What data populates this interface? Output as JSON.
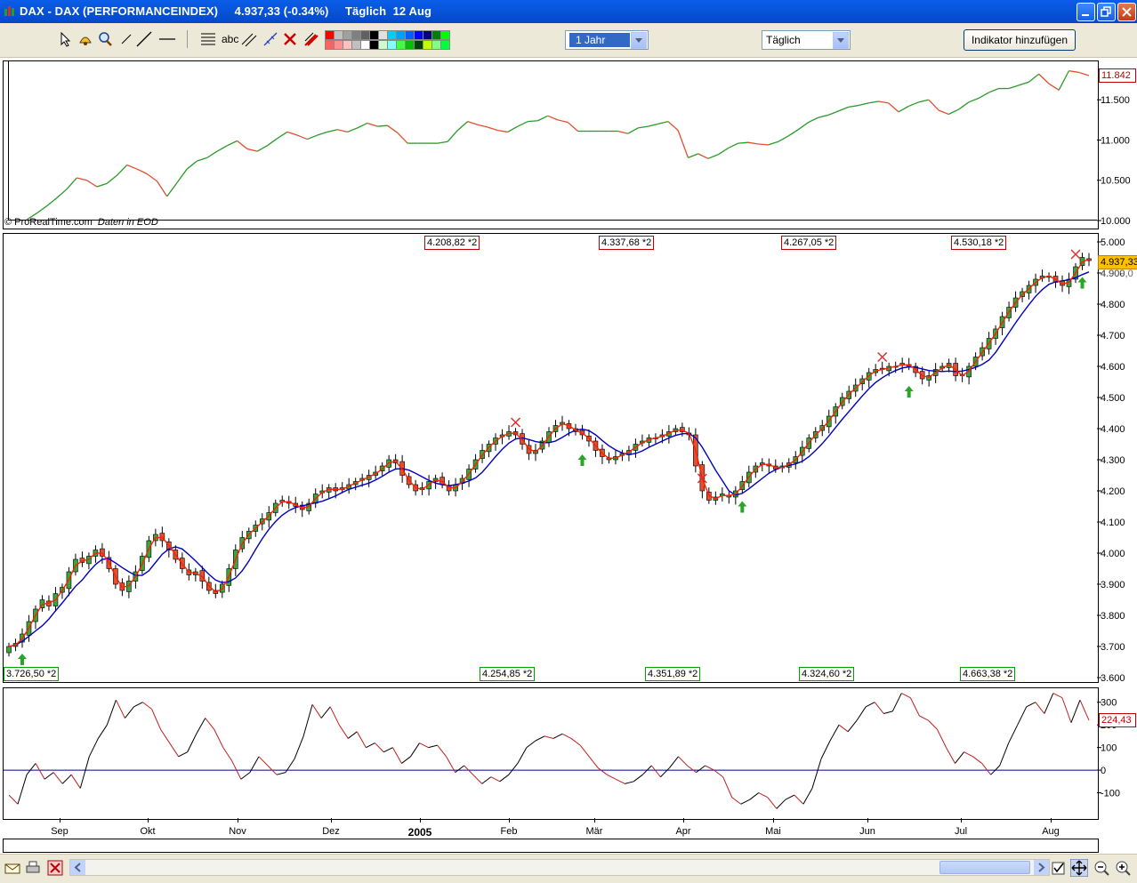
{
  "window": {
    "title": "DAX - DAX (PERFORMANCEINDEX)     4.937,33 (-0.34%)     Täglich  12 Aug"
  },
  "toolbar": {
    "period_select": "1 Jahr",
    "interval_select": "Täglich",
    "add_indicator_label": "Indikator hinzufügen",
    "text_tool_label": "abc",
    "palette": [
      "#ff0000",
      "#c0c0c0",
      "#a0a0a0",
      "#808080",
      "#606060",
      "#000000",
      "#e0e0e0",
      "#00ccff",
      "#00a0ff",
      "#0060ff",
      "#0000ff",
      "#000080",
      "#008000",
      "#00ff00",
      "#ff6060",
      "#ff9090",
      "#ffc0c0",
      "#c0c0c0",
      "#ffffff",
      "#000000",
      "#ccffcc",
      "#80ffff",
      "#40ff40",
      "#00c000",
      "#004000",
      "#c0ff00",
      "#80ff80",
      "#00ff40"
    ]
  },
  "top_panel": {
    "watermark": "© ProRealTime.com",
    "watermark_note": "Daten in EOD",
    "current_value": "11.842",
    "ticks": [
      "11.500",
      "11.000",
      "10.500",
      "10.000"
    ]
  },
  "main_panel": {
    "current_price": "4.937,33",
    "hidden_label": "4.909,0",
    "ticks": [
      "5.000",
      "4.900",
      "4.800",
      "4.700",
      "4.600",
      "4.500",
      "4.400",
      "4.300",
      "4.200",
      "4.100",
      "4.000",
      "3.900",
      "3.800",
      "3.700",
      "3.600"
    ],
    "highs": [
      "4.208,82 *2",
      "4.337,68 *2",
      "4.267,05 *2",
      "4.530,18 *2"
    ],
    "lows": [
      "3.726,50 *2",
      "4.254,85 *2",
      "4.351,89 *2",
      "4.324,60 *2",
      "4.663,38 *2"
    ]
  },
  "osc_panel": {
    "current_value": "224,43",
    "ticks": [
      "300",
      "200",
      "100",
      "0",
      "-100"
    ]
  },
  "x_axis": {
    "months": [
      "Sep",
      "Okt",
      "Nov",
      "Dez",
      "2005",
      "Feb",
      "Mär",
      "Apr",
      "Mai",
      "Jun",
      "Jul",
      "Aug"
    ]
  },
  "colors": {
    "title_bar": "#0a5ee8",
    "up_candle": "#3aa53a",
    "down_candle": "#e05030",
    "ma_fast": "#ff2000",
    "ma_slow": "#0000c0",
    "top_line": "#2a9a2a",
    "arrow_buy": "#2aa52a",
    "sell_mark": "#e03030"
  },
  "chart_data": [
    {
      "type": "line",
      "title": "",
      "ylim": [
        10000,
        11900
      ],
      "series": [
        {
          "values": [
            10010,
            10090,
            10180,
            10280,
            10390,
            10530,
            10500,
            10420,
            10460,
            10560,
            10690,
            10640,
            10580,
            10490,
            10300,
            10470,
            10640,
            10740,
            10780,
            10860,
            10930,
            10990,
            10890,
            10860,
            10930,
            11020,
            11100,
            11060,
            11010,
            11060,
            11100,
            11130,
            11100,
            11150,
            11210,
            11170,
            11180,
            11090,
            10960,
            10960,
            10960,
            10960,
            10980,
            11120,
            11230,
            11190,
            11160,
            11120,
            11100,
            11170,
            11230,
            11240,
            11300,
            11250,
            11220,
            11110,
            11110,
            11110,
            11110,
            11110,
            11080,
            11150,
            11170,
            11200,
            11230,
            11120,
            10780,
            10830,
            10770,
            10820,
            10900,
            10960,
            10970,
            10950,
            10940,
            10980,
            11050,
            11130,
            11220,
            11280,
            11310,
            11360,
            11410,
            11430,
            11460,
            11480,
            11460,
            11350,
            11420,
            11470,
            11500,
            11370,
            11320,
            11380,
            11470,
            11520,
            11590,
            11640,
            11640,
            11680,
            11720,
            11820,
            11700,
            11620,
            11860,
            11840,
            11800
          ]
        }
      ]
    },
    {
      "type": "bar",
      "title": "",
      "ylim": [
        3600,
        5000
      ],
      "series": [
        {
          "name": "",
          "values": [
            3700,
            3710,
            3740,
            3780,
            3820,
            3850,
            3830,
            3870,
            3890,
            3940,
            3980,
            3970,
            3990,
            4010,
            3990,
            3950,
            3900,
            3880,
            3910,
            3940,
            3990,
            4040,
            4060,
            4040,
            4010,
            3980,
            3950,
            3930,
            3940,
            3910,
            3880,
            3870,
            3900,
            3950,
            4010,
            4050,
            4070,
            4090,
            4110,
            4130,
            4160,
            4170,
            4160,
            4150,
            4140,
            4160,
            4190,
            4200,
            4210,
            4200,
            4210,
            4220,
            4230,
            4240,
            4250,
            4260,
            4280,
            4300,
            4290,
            4250,
            4220,
            4200,
            4210,
            4230,
            4240,
            4220,
            4200,
            4220,
            4240,
            4270,
            4300,
            4330,
            4350,
            4370,
            4380,
            4390,
            4380,
            4350,
            4320,
            4330,
            4360,
            4390,
            4410,
            4420,
            4400,
            4390,
            4380,
            4360,
            4330,
            4310,
            4300,
            4310,
            4320,
            4330,
            4350,
            4360,
            4370,
            4370,
            4380,
            4390,
            4400,
            4390,
            4380,
            4280,
            4200,
            4170,
            4180,
            4190,
            4180,
            4200,
            4230,
            4260,
            4280,
            4290,
            4280,
            4270,
            4280,
            4290,
            4310,
            4340,
            4370,
            4390,
            4410,
            4440,
            4470,
            4500,
            4520,
            4540,
            4560,
            4580,
            4590,
            4590,
            4600,
            4600,
            4610,
            4600,
            4580,
            4560,
            4570,
            4590,
            4600,
            4610,
            4570,
            4570,
            4600,
            4630,
            4660,
            4690,
            4720,
            4760,
            4790,
            4820,
            4840,
            4860,
            4880,
            4890,
            4890,
            4870,
            4860,
            4880,
            4920,
            4950,
            4940
          ]
        }
      ]
    },
    {
      "type": "line",
      "title": "",
      "ylim": [
        -200,
        350
      ],
      "series": [
        {
          "values": [
            -110,
            -150,
            -20,
            30,
            -40,
            -10,
            -60,
            -20,
            -80,
            60,
            140,
            200,
            310,
            230,
            280,
            300,
            270,
            180,
            120,
            60,
            80,
            160,
            230,
            180,
            100,
            40,
            -40,
            -10,
            60,
            20,
            -20,
            -10,
            50,
            150,
            290,
            230,
            280,
            200,
            140,
            170,
            100,
            120,
            80,
            100,
            30,
            60,
            120,
            100,
            110,
            60,
            -10,
            20,
            -20,
            -60,
            -30,
            -50,
            -20,
            30,
            100,
            130,
            150,
            140,
            160,
            140,
            110,
            60,
            10,
            -20,
            -40,
            -60,
            -50,
            -20,
            20,
            -30,
            10,
            60,
            20,
            -10,
            20,
            0,
            -30,
            -120,
            -150,
            -130,
            -100,
            -120,
            -170,
            -130,
            -110,
            -150,
            -80,
            50,
            130,
            200,
            170,
            220,
            280,
            300,
            250,
            260,
            340,
            320,
            240,
            220,
            180,
            100,
            30,
            80,
            60,
            30,
            -20,
            20,
            120,
            200,
            280,
            300,
            250,
            340,
            320,
            210,
            310,
            220
          ]
        }
      ]
    }
  ]
}
